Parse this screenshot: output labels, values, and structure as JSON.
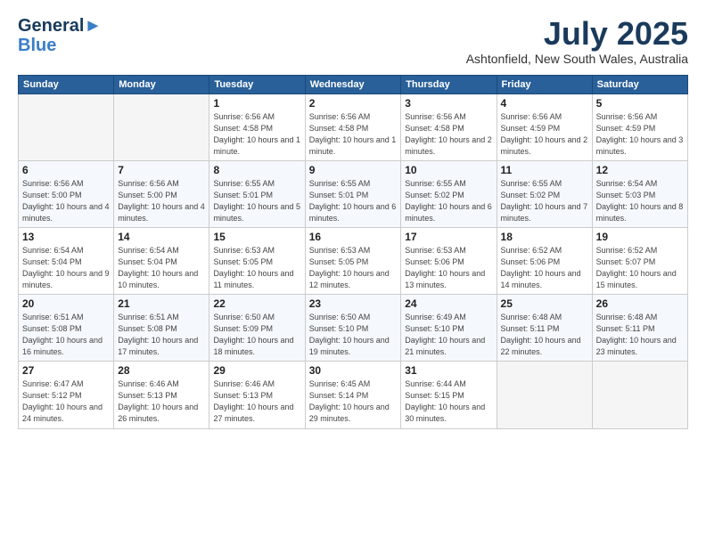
{
  "header": {
    "logo_line1a": "General",
    "logo_line1b": "Blue",
    "month_title": "July 2025",
    "location": "Ashtonfield, New South Wales, Australia"
  },
  "columns": [
    "Sunday",
    "Monday",
    "Tuesday",
    "Wednesday",
    "Thursday",
    "Friday",
    "Saturday"
  ],
  "weeks": [
    [
      {
        "day": "",
        "info": ""
      },
      {
        "day": "",
        "info": ""
      },
      {
        "day": "1",
        "info": "Sunrise: 6:56 AM\nSunset: 4:58 PM\nDaylight: 10 hours and 1 minute."
      },
      {
        "day": "2",
        "info": "Sunrise: 6:56 AM\nSunset: 4:58 PM\nDaylight: 10 hours and 1 minute."
      },
      {
        "day": "3",
        "info": "Sunrise: 6:56 AM\nSunset: 4:58 PM\nDaylight: 10 hours and 2 minutes."
      },
      {
        "day": "4",
        "info": "Sunrise: 6:56 AM\nSunset: 4:59 PM\nDaylight: 10 hours and 2 minutes."
      },
      {
        "day": "5",
        "info": "Sunrise: 6:56 AM\nSunset: 4:59 PM\nDaylight: 10 hours and 3 minutes."
      }
    ],
    [
      {
        "day": "6",
        "info": "Sunrise: 6:56 AM\nSunset: 5:00 PM\nDaylight: 10 hours and 4 minutes."
      },
      {
        "day": "7",
        "info": "Sunrise: 6:56 AM\nSunset: 5:00 PM\nDaylight: 10 hours and 4 minutes."
      },
      {
        "day": "8",
        "info": "Sunrise: 6:55 AM\nSunset: 5:01 PM\nDaylight: 10 hours and 5 minutes."
      },
      {
        "day": "9",
        "info": "Sunrise: 6:55 AM\nSunset: 5:01 PM\nDaylight: 10 hours and 6 minutes."
      },
      {
        "day": "10",
        "info": "Sunrise: 6:55 AM\nSunset: 5:02 PM\nDaylight: 10 hours and 6 minutes."
      },
      {
        "day": "11",
        "info": "Sunrise: 6:55 AM\nSunset: 5:02 PM\nDaylight: 10 hours and 7 minutes."
      },
      {
        "day": "12",
        "info": "Sunrise: 6:54 AM\nSunset: 5:03 PM\nDaylight: 10 hours and 8 minutes."
      }
    ],
    [
      {
        "day": "13",
        "info": "Sunrise: 6:54 AM\nSunset: 5:04 PM\nDaylight: 10 hours and 9 minutes."
      },
      {
        "day": "14",
        "info": "Sunrise: 6:54 AM\nSunset: 5:04 PM\nDaylight: 10 hours and 10 minutes."
      },
      {
        "day": "15",
        "info": "Sunrise: 6:53 AM\nSunset: 5:05 PM\nDaylight: 10 hours and 11 minutes."
      },
      {
        "day": "16",
        "info": "Sunrise: 6:53 AM\nSunset: 5:05 PM\nDaylight: 10 hours and 12 minutes."
      },
      {
        "day": "17",
        "info": "Sunrise: 6:53 AM\nSunset: 5:06 PM\nDaylight: 10 hours and 13 minutes."
      },
      {
        "day": "18",
        "info": "Sunrise: 6:52 AM\nSunset: 5:06 PM\nDaylight: 10 hours and 14 minutes."
      },
      {
        "day": "19",
        "info": "Sunrise: 6:52 AM\nSunset: 5:07 PM\nDaylight: 10 hours and 15 minutes."
      }
    ],
    [
      {
        "day": "20",
        "info": "Sunrise: 6:51 AM\nSunset: 5:08 PM\nDaylight: 10 hours and 16 minutes."
      },
      {
        "day": "21",
        "info": "Sunrise: 6:51 AM\nSunset: 5:08 PM\nDaylight: 10 hours and 17 minutes."
      },
      {
        "day": "22",
        "info": "Sunrise: 6:50 AM\nSunset: 5:09 PM\nDaylight: 10 hours and 18 minutes."
      },
      {
        "day": "23",
        "info": "Sunrise: 6:50 AM\nSunset: 5:10 PM\nDaylight: 10 hours and 19 minutes."
      },
      {
        "day": "24",
        "info": "Sunrise: 6:49 AM\nSunset: 5:10 PM\nDaylight: 10 hours and 21 minutes."
      },
      {
        "day": "25",
        "info": "Sunrise: 6:48 AM\nSunset: 5:11 PM\nDaylight: 10 hours and 22 minutes."
      },
      {
        "day": "26",
        "info": "Sunrise: 6:48 AM\nSunset: 5:11 PM\nDaylight: 10 hours and 23 minutes."
      }
    ],
    [
      {
        "day": "27",
        "info": "Sunrise: 6:47 AM\nSunset: 5:12 PM\nDaylight: 10 hours and 24 minutes."
      },
      {
        "day": "28",
        "info": "Sunrise: 6:46 AM\nSunset: 5:13 PM\nDaylight: 10 hours and 26 minutes."
      },
      {
        "day": "29",
        "info": "Sunrise: 6:46 AM\nSunset: 5:13 PM\nDaylight: 10 hours and 27 minutes."
      },
      {
        "day": "30",
        "info": "Sunrise: 6:45 AM\nSunset: 5:14 PM\nDaylight: 10 hours and 29 minutes."
      },
      {
        "day": "31",
        "info": "Sunrise: 6:44 AM\nSunset: 5:15 PM\nDaylight: 10 hours and 30 minutes."
      },
      {
        "day": "",
        "info": ""
      },
      {
        "day": "",
        "info": ""
      }
    ]
  ]
}
